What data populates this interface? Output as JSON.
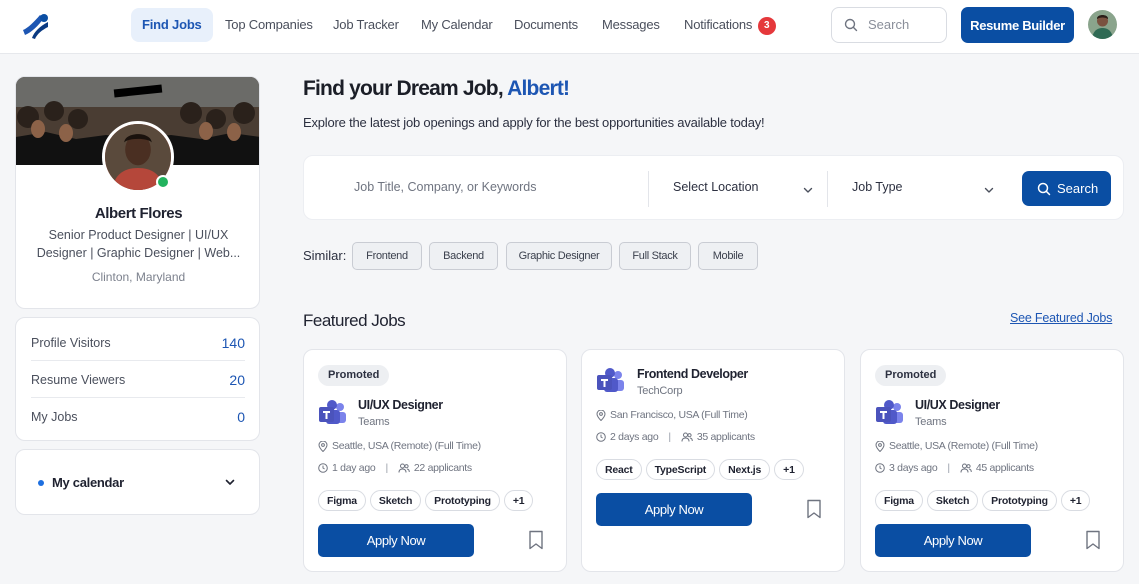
{
  "nav": {
    "links": [
      {
        "label": "Find Jobs",
        "active": true
      },
      {
        "label": "Top Companies"
      },
      {
        "label": "Job Tracker"
      },
      {
        "label": "My Calendar"
      },
      {
        "label": "Documents"
      },
      {
        "label": "Messages"
      },
      {
        "label": "Notifications",
        "badge": "3"
      }
    ],
    "search_placeholder": "Search",
    "resume_builder": "Resume Builder"
  },
  "profile": {
    "name": "Albert Flores",
    "title": "Senior Product Designer | UI/UX Designer | Graphic Designer | Web...",
    "location": "Clinton, Maryland",
    "online": true
  },
  "stats": [
    {
      "label": "Profile Visitors",
      "value": "140"
    },
    {
      "label": "Resume Viewers",
      "value": "20"
    },
    {
      "label": "My Jobs",
      "value": "0"
    }
  ],
  "calendar": {
    "label": "My calendar"
  },
  "hero": {
    "title_prefix": "Find your Dream Job,",
    "name": "Albert!",
    "subtitle": "Explore the latest job openings and apply for the best opportunities available today!"
  },
  "search": {
    "keyword_placeholder": "Job Title, Company, or Keywords",
    "location_label": "Select Location",
    "type_label": "Job Type",
    "button": "Search"
  },
  "similar": {
    "label": "Similar:",
    "chips": [
      "Frontend",
      "Backend",
      "Graphic Designer",
      "Full Stack",
      "Mobile"
    ]
  },
  "featured": {
    "title": "Featured Jobs",
    "see_all": "See Featured Jobs",
    "jobs": [
      {
        "promoted": "Promoted",
        "title": "UI/UX Designer",
        "company": "Teams",
        "location": "Seattle, USA (Remote) (Full Time)",
        "posted": "1 day ago",
        "applicants": "22 applicants",
        "tags": [
          "Figma",
          "Sketch",
          "Prototyping",
          "+1"
        ],
        "apply": "Apply Now"
      },
      {
        "promoted": "",
        "title": "Frontend Developer",
        "company": "TechCorp",
        "location": "San Francisco, USA (Full Time)",
        "posted": "2 days ago",
        "applicants": "35 applicants",
        "tags": [
          "React",
          "TypeScript",
          "Next.js",
          "+1"
        ],
        "apply": "Apply Now"
      },
      {
        "promoted": "Promoted",
        "title": "UI/UX Designer",
        "company": "Teams",
        "location": "Seattle, USA (Remote) (Full Time)",
        "posted": "3 days ago",
        "applicants": "45 applicants",
        "tags": [
          "Figma",
          "Sketch",
          "Prototyping",
          "+1"
        ],
        "apply": "Apply Now"
      }
    ]
  },
  "colors": {
    "primary": "#0a4ea3",
    "accent": "#1d56b3",
    "badge": "#e5383b",
    "online": "#22b35e"
  }
}
